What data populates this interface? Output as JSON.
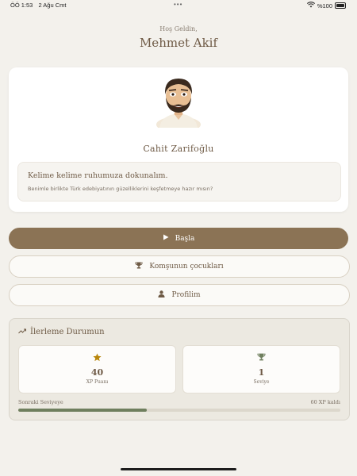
{
  "status_bar": {
    "time": "ÖÖ 1:53",
    "date": "2 Ağu Cmt",
    "battery": "%100"
  },
  "header": {
    "greeting": "Hoş Geldin,",
    "user_name": "Mehmet Akif"
  },
  "mentor": {
    "name": "Cahit Zarifoğlu",
    "quote": "Kelime kelime ruhumuza dokunalım.",
    "subtext": "Benimle birlikte Türk edebiyatının güzelliklerini keşfetmeye hazır mısın?"
  },
  "actions": {
    "start_label": "Başla",
    "book_label": "Komşunun çocukları",
    "profile_label": "Profilim"
  },
  "progress": {
    "title": "İlerleme Durumun",
    "xp_value": "40",
    "xp_label": "XP Puanı",
    "level_value": "1",
    "level_label": "Seviye",
    "next_level_label": "Sonraki Seviyeye",
    "xp_remaining": "60 XP kaldı",
    "fill_percent": 40
  },
  "colors": {
    "accent": "#8b7355",
    "progress_fill": "#6f7f5e",
    "star": "#b8860b",
    "trophy": "#6f7f5e"
  }
}
